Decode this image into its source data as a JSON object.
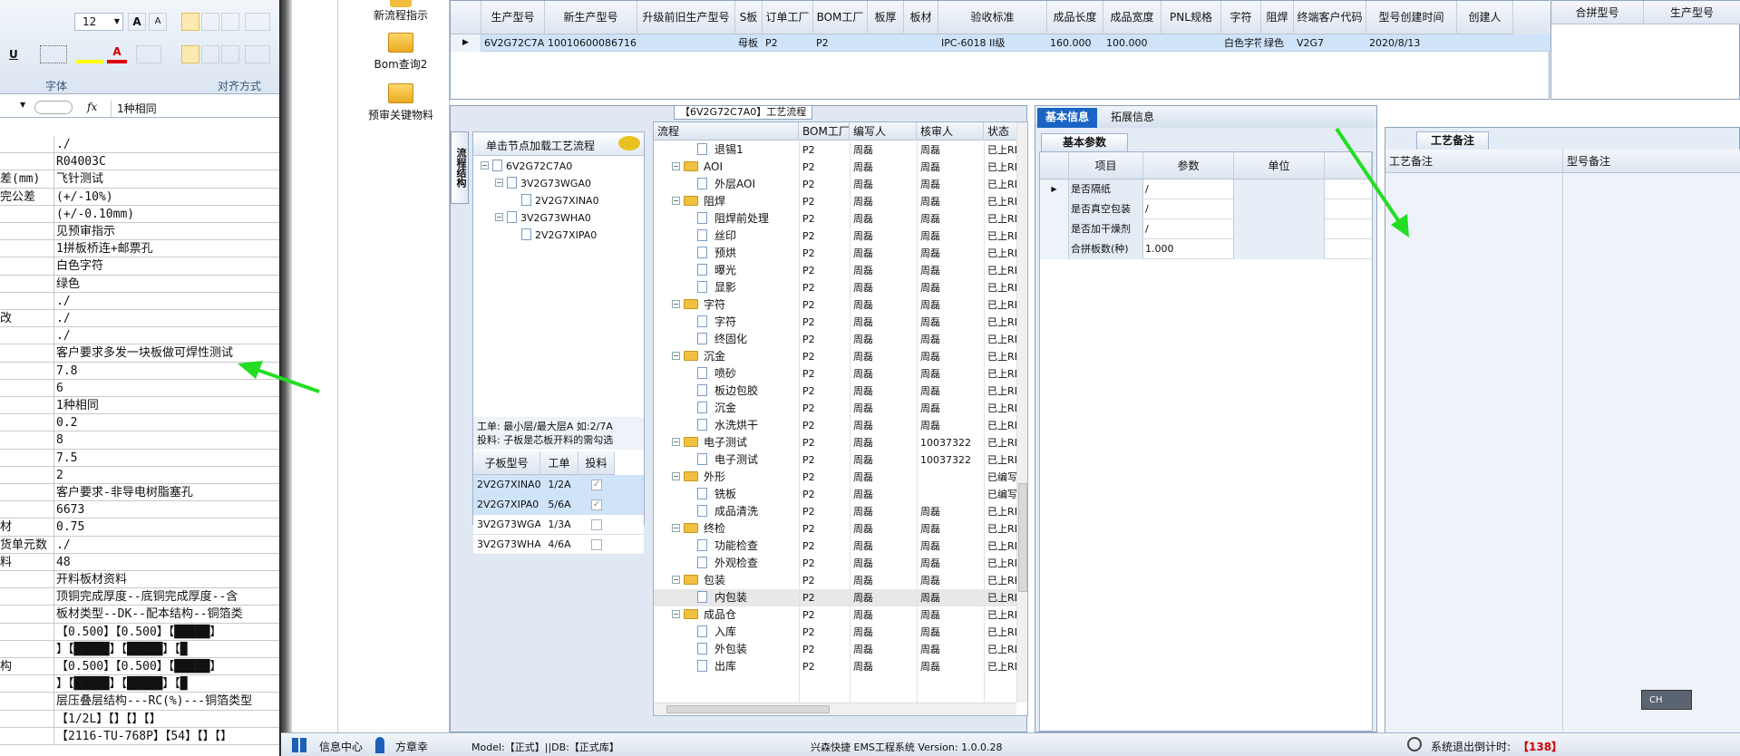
{
  "excel": {
    "font_size": "12",
    "group_font": "字体",
    "group_align": "对齐方式",
    "formula_icon": "fx",
    "formula_value": "1种相同",
    "row_labels": [
      "",
      "",
      "差(mm)",
      "完公差",
      "",
      "",
      "",
      "",
      "",
      "",
      "改",
      "",
      "",
      "",
      "",
      "",
      "",
      "",
      "",
      "",
      "",
      "",
      "材",
      "货单元数",
      "料",
      "",
      "",
      "",
      "",
      "",
      "构",
      "",
      ""
    ],
    "row_values": [
      "./",
      "R04003C",
      "飞针测试",
      "(+/-10%)",
      "(+/-0.10mm)",
      "见预审指示",
      "1拼板桥连+邮票孔",
      "白色字符",
      "绿色",
      "./",
      "./",
      "./",
      "客户要求多发一块板做可焊性测试",
      "7.8",
      "6",
      "1种相同",
      "0.2",
      "8",
      "7.5",
      "2",
      "客户要求-非导电树脂塞孔",
      "6673",
      "0.75",
      "./",
      "48",
      "开料板材资料",
      "顶铜完成厚度--底铜完成厚度--含",
      "板材类型--DK--配本结构--铜箔类",
      "【0.500】【0.500】【█████】",
      "】【█████】【█████】【█",
      "【0.500】【0.500】【█████】",
      "】【█████】【█████】【█",
      "层压叠层结构---RC(%)---铜箔类型",
      "【1/2L】【】【】【】",
      "【2116-TU-768P】【54】【】【】"
    ]
  },
  "nav": {
    "items": [
      "新流程指示",
      "Bom查询2",
      "预审关键物料"
    ]
  },
  "top_table": {
    "headers": [
      "生产型号",
      "新生产型号",
      "升级前旧生产型号",
      "S板",
      "订单工厂",
      "BOM工厂",
      "板厚",
      "板材",
      "验收标准",
      "成品长度",
      "成品宽度",
      "PNL规格",
      "字符",
      "阻焊",
      "终端客户代码",
      "型号创建时间",
      "创建人"
    ],
    "row": [
      "6V2G72C7A0",
      "10010600086716",
      "",
      "母板",
      "P2",
      "P2",
      "",
      "",
      "IPC-6018 II级",
      "160.000",
      "100.000",
      "",
      "白色字符",
      "绿色",
      "V2G7",
      "2020/8/13",
      ""
    ],
    "right_headers": [
      "合拼型号",
      "生产型号"
    ]
  },
  "process_panel": {
    "title": "【6V2G72C7A0】工艺流程",
    "side_tab": "流程结构",
    "hint": "单击节点加载工艺流程",
    "tree": [
      "6V2G72C7A0",
      "3V2G73WGA0",
      "2V2G7XINA0",
      "3V2G73WHA0",
      "2V2G7XIPA0"
    ],
    "note1": "工单: 最小层/最大层A 如:2/7A",
    "note2": "投料: 子板是芯板开料的需勾选",
    "sub_headers": [
      "子板型号",
      "工单",
      "投料"
    ],
    "sub_rows": [
      {
        "model": "2V2G7XINA0",
        "order": "1/2A",
        "checked": true
      },
      {
        "model": "2V2G7XIPA0",
        "order": "5/6A",
        "checked": true
      },
      {
        "model": "3V2G73WGA0",
        "order": "1/3A",
        "checked": false
      },
      {
        "model": "3V2G73WHA0",
        "order": "4/6A",
        "checked": false
      }
    ]
  },
  "flow": {
    "headers": [
      "流程",
      "BOM工厂",
      "编写人",
      "核审人",
      "状态"
    ],
    "rows": [
      {
        "name": "退锡1",
        "level": 2,
        "folder": false,
        "bom": "P2",
        "writer": "周磊",
        "reviewer": "周磊",
        "status": "已上REL"
      },
      {
        "name": "AOI",
        "level": 1,
        "folder": true,
        "bom": "P2",
        "writer": "周磊",
        "reviewer": "周磊",
        "status": "已上REL"
      },
      {
        "name": "外层AOI",
        "level": 2,
        "folder": false,
        "bom": "P2",
        "writer": "周磊",
        "reviewer": "周磊",
        "status": "已上REL"
      },
      {
        "name": "阻焊",
        "level": 1,
        "folder": true,
        "bom": "P2",
        "writer": "周磊",
        "reviewer": "周磊",
        "status": "已上REL"
      },
      {
        "name": "阻焊前处理",
        "level": 2,
        "folder": false,
        "bom": "P2",
        "writer": "周磊",
        "reviewer": "周磊",
        "status": "已上REL"
      },
      {
        "name": "丝印",
        "level": 2,
        "folder": false,
        "bom": "P2",
        "writer": "周磊",
        "reviewer": "周磊",
        "status": "已上REL"
      },
      {
        "name": "预烘",
        "level": 2,
        "folder": false,
        "bom": "P2",
        "writer": "周磊",
        "reviewer": "周磊",
        "status": "已上REL"
      },
      {
        "name": "曝光",
        "level": 2,
        "folder": false,
        "bom": "P2",
        "writer": "周磊",
        "reviewer": "周磊",
        "status": "已上REL"
      },
      {
        "name": "显影",
        "level": 2,
        "folder": false,
        "bom": "P2",
        "writer": "周磊",
        "reviewer": "周磊",
        "status": "已上REL"
      },
      {
        "name": "字符",
        "level": 1,
        "folder": true,
        "bom": "P2",
        "writer": "周磊",
        "reviewer": "周磊",
        "status": "已上REL"
      },
      {
        "name": "字符",
        "level": 2,
        "folder": false,
        "bom": "P2",
        "writer": "周磊",
        "reviewer": "周磊",
        "status": "已上REL"
      },
      {
        "name": "终固化",
        "level": 2,
        "folder": false,
        "bom": "P2",
        "writer": "周磊",
        "reviewer": "周磊",
        "status": "已上REL"
      },
      {
        "name": "沉金",
        "level": 1,
        "folder": true,
        "bom": "P2",
        "writer": "周磊",
        "reviewer": "周磊",
        "status": "已上REL"
      },
      {
        "name": "喷砂",
        "level": 2,
        "folder": false,
        "bom": "P2",
        "writer": "周磊",
        "reviewer": "周磊",
        "status": "已上REL"
      },
      {
        "name": "板边包胶",
        "level": 2,
        "folder": false,
        "bom": "P2",
        "writer": "周磊",
        "reviewer": "周磊",
        "status": "已上REL"
      },
      {
        "name": "沉金",
        "level": 2,
        "folder": false,
        "bom": "P2",
        "writer": "周磊",
        "reviewer": "周磊",
        "status": "已上REL"
      },
      {
        "name": "水洗烘干",
        "level": 2,
        "folder": false,
        "bom": "P2",
        "writer": "周磊",
        "reviewer": "周磊",
        "status": "已上REL"
      },
      {
        "name": "电子测试",
        "level": 1,
        "folder": true,
        "bom": "P2",
        "writer": "周磊",
        "reviewer": "10037322",
        "status": "已上REL"
      },
      {
        "name": "电子测试",
        "level": 2,
        "folder": false,
        "bom": "P2",
        "writer": "周磊",
        "reviewer": "10037322",
        "status": "已上REL"
      },
      {
        "name": "外形",
        "level": 1,
        "folder": true,
        "bom": "P2",
        "writer": "周磊",
        "reviewer": "",
        "status": "已编写"
      },
      {
        "name": "铣板",
        "level": 2,
        "folder": false,
        "bom": "P2",
        "writer": "周磊",
        "reviewer": "",
        "status": "已编写"
      },
      {
        "name": "成品清洗",
        "level": 2,
        "folder": false,
        "bom": "P2",
        "writer": "周磊",
        "reviewer": "周磊",
        "status": "已上REL"
      },
      {
        "name": "终检",
        "level": 1,
        "folder": true,
        "bom": "P2",
        "writer": "周磊",
        "reviewer": "周磊",
        "status": "已上REL"
      },
      {
        "name": "功能检查",
        "level": 2,
        "folder": false,
        "bom": "P2",
        "writer": "周磊",
        "reviewer": "周磊",
        "status": "已上REL"
      },
      {
        "name": "外观检查",
        "level": 2,
        "folder": false,
        "bom": "P2",
        "writer": "周磊",
        "reviewer": "周磊",
        "status": "已上REL"
      },
      {
        "name": "包装",
        "level": 1,
        "folder": true,
        "bom": "P2",
        "writer": "周磊",
        "reviewer": "周磊",
        "status": "已上REL"
      },
      {
        "name": "内包装",
        "level": 2,
        "folder": false,
        "bom": "P2",
        "writer": "周磊",
        "reviewer": "周磊",
        "status": "已上REL"
      },
      {
        "name": "成品仓",
        "level": 1,
        "folder": true,
        "bom": "P2",
        "writer": "周磊",
        "reviewer": "周磊",
        "status": "已上REL"
      },
      {
        "name": "入库",
        "level": 2,
        "folder": false,
        "bom": "P2",
        "writer": "周磊",
        "reviewer": "周磊",
        "status": "已上REL"
      },
      {
        "name": "外包装",
        "level": 2,
        "folder": false,
        "bom": "P2",
        "writer": "周磊",
        "reviewer": "周磊",
        "status": "已上REL"
      },
      {
        "name": "出库",
        "level": 2,
        "folder": false,
        "bom": "P2",
        "writer": "周磊",
        "reviewer": "周磊",
        "status": "已上REL"
      }
    ]
  },
  "basic": {
    "tabs": [
      "基本信息",
      "拓展信息"
    ],
    "sub_tab": "基本参数",
    "headers": [
      "项目",
      "参数",
      "单位"
    ],
    "rows": [
      {
        "item": "是否隔纸",
        "param": "/",
        "unit": ""
      },
      {
        "item": "是否真空包装",
        "param": "/",
        "unit": ""
      },
      {
        "item": "是否加干燥剂",
        "param": "/",
        "unit": ""
      },
      {
        "item": "合拼板数(种)",
        "param": "1.000",
        "unit": ""
      }
    ]
  },
  "notes_panel": {
    "tab": "工艺备注",
    "headers": [
      "工艺备注",
      "型号备注"
    ]
  },
  "status_bar": {
    "info_center": "信息中心",
    "user": "方章幸",
    "model": "Model:【正式】||DB:【正式库】",
    "system": "兴森快捷 EMS工程系统 Version: 1.0.0.28",
    "countdown_label": "系统退出倒计时:",
    "countdown_value": "【138】",
    "ime": "CH"
  },
  "colors": {
    "accent": "#1b64c4",
    "arrow": "#22dd22",
    "selected": "#cfe3f9"
  }
}
